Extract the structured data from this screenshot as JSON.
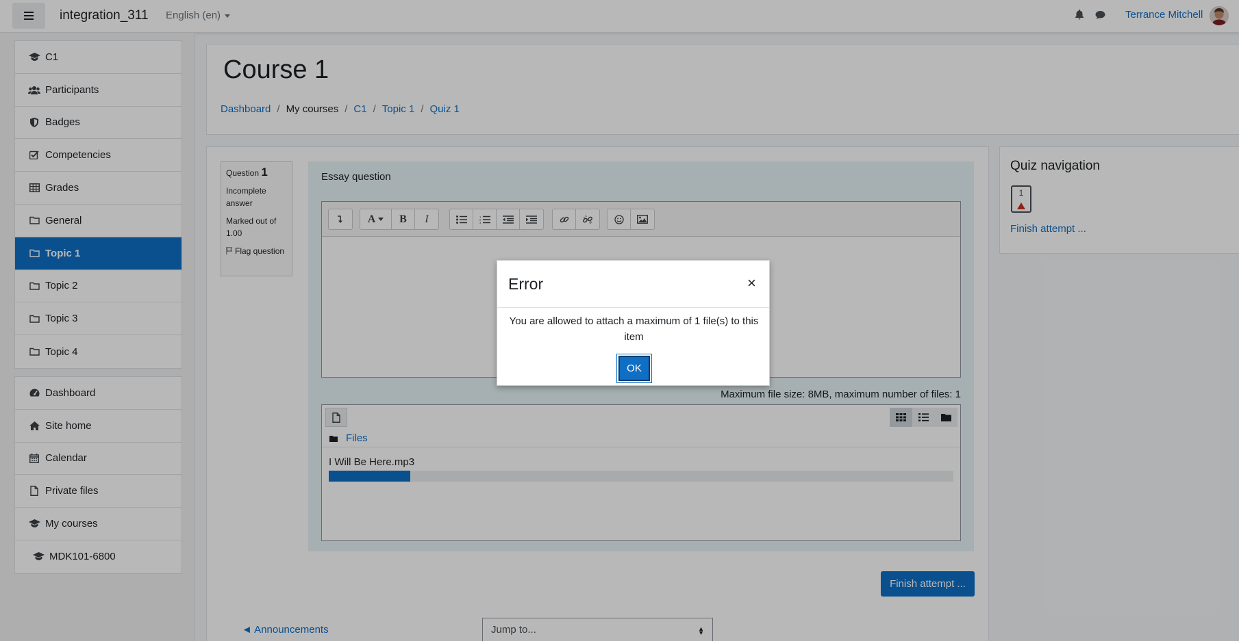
{
  "navbar": {
    "site_name": "integration_311",
    "language": "English (en)",
    "user_name": "Terrance Mitchell"
  },
  "drawer": {
    "course_items": [
      {
        "label": "C1",
        "icon": "graduation-cap-icon"
      },
      {
        "label": "Participants",
        "icon": "users-icon"
      },
      {
        "label": "Badges",
        "icon": "shield-icon"
      },
      {
        "label": "Competencies",
        "icon": "check-square-icon"
      },
      {
        "label": "Grades",
        "icon": "table-icon"
      },
      {
        "label": "General",
        "icon": "folder-icon"
      },
      {
        "label": "Topic 1",
        "icon": "folder-icon",
        "active": true
      },
      {
        "label": "Topic 2",
        "icon": "folder-icon"
      },
      {
        "label": "Topic 3",
        "icon": "folder-icon"
      },
      {
        "label": "Topic 4",
        "icon": "folder-icon"
      }
    ],
    "site_items": [
      {
        "label": "Dashboard",
        "icon": "tachometer-icon"
      },
      {
        "label": "Site home",
        "icon": "home-icon"
      },
      {
        "label": "Calendar",
        "icon": "calendar-icon"
      },
      {
        "label": "Private files",
        "icon": "file-icon"
      },
      {
        "label": "My courses",
        "icon": "graduation-cap-icon"
      },
      {
        "label": "MDK101-6800",
        "icon": "graduation-cap-icon"
      }
    ]
  },
  "header": {
    "title": "Course 1",
    "breadcrumb": [
      "Dashboard",
      "My courses",
      "C1",
      "Topic 1",
      "Quiz 1"
    ]
  },
  "question": {
    "label": "Question",
    "number": "1",
    "state": "Incomplete answer",
    "marks": "Marked out of 1.00",
    "flag": "Flag question",
    "prompt": "Essay question",
    "file_limit": "Maximum file size: 8MB, maximum number of files: 1",
    "files_label": "Files",
    "uploading_file": "I Will Be Here.mp3",
    "upload_progress": 0.13
  },
  "finish_button": "Finish attempt ...",
  "prev_link": "◄ Announcements",
  "jump_placeholder": "Jump to...",
  "quiz_nav": {
    "title": "Quiz navigation",
    "question_button": "1",
    "finish_link": "Finish attempt ..."
  },
  "modal": {
    "title": "Error",
    "close": "×",
    "message": "You are allowed to attach a maximum of 1 file(s) to this item",
    "ok": "OK"
  },
  "colors": {
    "brand": "#0f6fc5",
    "flag": "#ca3120"
  }
}
